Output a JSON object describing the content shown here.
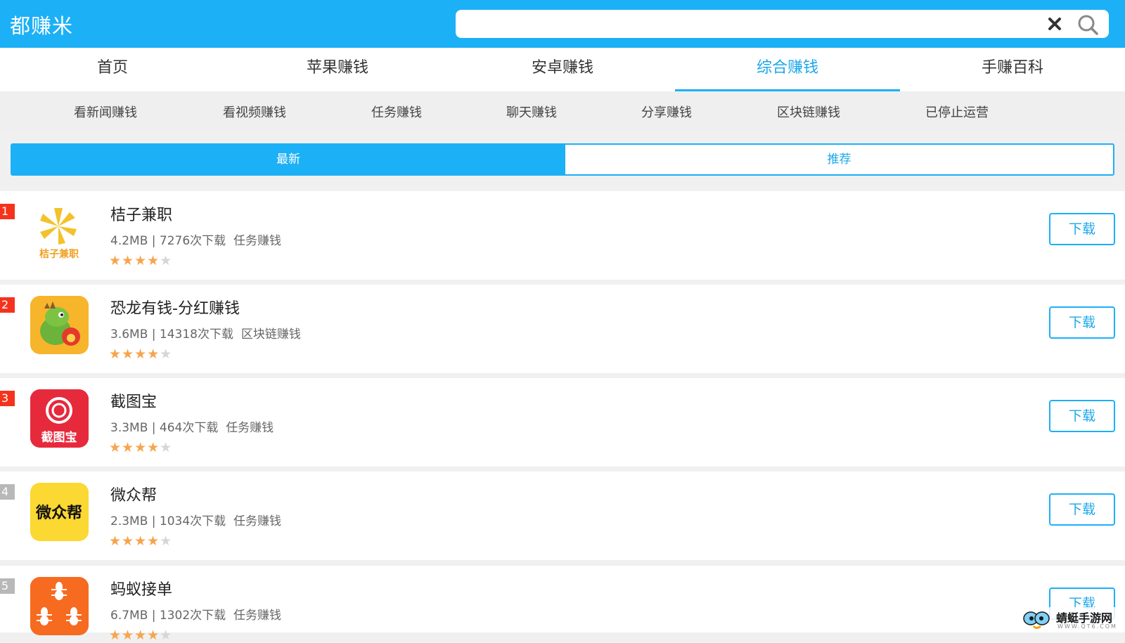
{
  "header": {
    "brand": "都赚米",
    "search": {
      "value": "",
      "placeholder": ""
    }
  },
  "tabs": [
    {
      "label": "首页"
    },
    {
      "label": "苹果赚钱"
    },
    {
      "label": "安卓赚钱"
    },
    {
      "label": "综合赚钱",
      "active": true
    },
    {
      "label": "手赚百科"
    }
  ],
  "subnav": [
    "看新闻赚钱",
    "看视频赚钱",
    "任务赚钱",
    "聊天赚钱",
    "分享赚钱",
    "区块链赚钱",
    "已停止运营"
  ],
  "toggle": {
    "latest": "最新",
    "recommended": "推荐",
    "selected": "最新"
  },
  "apps": [
    {
      "rank": "1",
      "name": "桔子兼职",
      "size": "4.2MB",
      "downloads": "7276次下载",
      "category": "任务赚钱",
      "rating": 4,
      "icon": "orange-slice-icon",
      "icon_text": "桔子兼职",
      "button": "下载"
    },
    {
      "rank": "2",
      "name": "恐龙有钱-分红赚钱",
      "size": "3.6MB",
      "downloads": "14318次下载",
      "category": "区块链赚钱",
      "rating": 4,
      "icon": "dinosaur-icon",
      "button": "下载"
    },
    {
      "rank": "3",
      "name": "截图宝",
      "size": "3.3MB",
      "downloads": "464次下载",
      "category": "任务赚钱",
      "rating": 4,
      "icon": "screenshot-treasure-icon",
      "icon_text": "截图宝",
      "button": "下载"
    },
    {
      "rank": "4",
      "name": "微众帮",
      "size": "2.3MB",
      "downloads": "1034次下载",
      "category": "任务赚钱",
      "rating": 4,
      "icon": "weizhongbang-icon",
      "icon_text": "微众帮",
      "button": "下载"
    },
    {
      "rank": "5",
      "name": "蚂蚁接单",
      "size": "6.7MB",
      "downloads": "1302次下载",
      "category": "任务赚钱",
      "rating": 4,
      "icon": "ant-icon",
      "button": "下载"
    }
  ],
  "watermark": {
    "title": "蜻蜓手游网",
    "url": "WWW.QT6.COM"
  },
  "colors": {
    "primary": "#1cb0f6",
    "rank_hot": "#f5331d",
    "rank_cold": "#b8b8b8",
    "star": "#f6a54c"
  }
}
